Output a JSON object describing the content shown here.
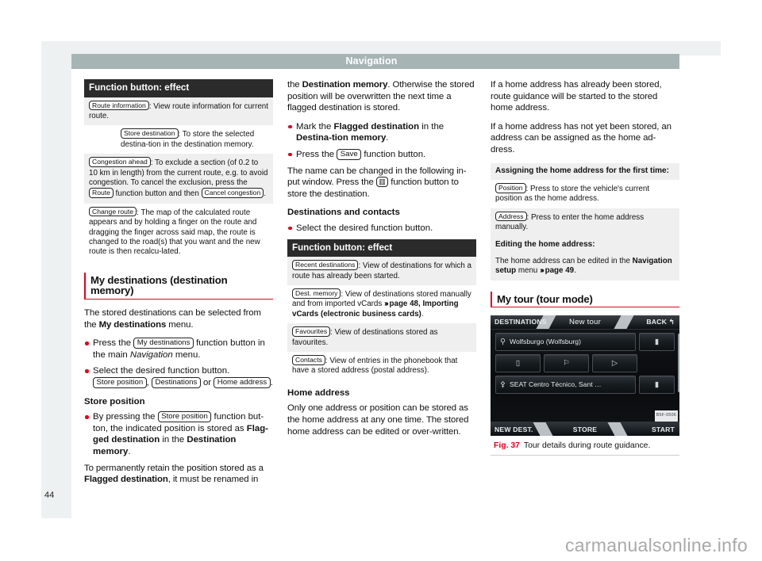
{
  "header": {
    "title": "Navigation"
  },
  "page_number": "44",
  "watermark": "carmanualsonline.info",
  "col1": {
    "table": {
      "head": "Function button: effect",
      "rows": [
        {
          "pill": "Route information",
          "text": ": View route information for current route."
        },
        {
          "pill": "Store destination",
          "text": ": To store the selected destina-tion in the destination memory."
        },
        {
          "pill": "Congestion ahead",
          "text": ": To exclude a section (of 0.2 to 10 km in length) from the current route, e.g. to avoid congestion. To cancel the exclusion, press the ",
          "pill2": "Route",
          "text2": " function button and then ",
          "pill3": "Cancel congestion",
          "text3": "."
        },
        {
          "pill": "Change route",
          "text": ": The map of the calculated route appears and by holding a finger on the route and dragging the finger across said map, the route is changed to the road(s) that you want and the new route is then recalcu-lated."
        }
      ]
    },
    "section_heading": "My destinations (destination memory)",
    "intro_a": "The stored destinations can be selected from the ",
    "intro_b": "My destinations",
    "intro_c": " menu.",
    "bullet1_a": "Press the ",
    "bullet1_pill": "My destinations",
    "bullet1_b": " function button in the main ",
    "bullet1_italic": "Navigation",
    "bullet1_c": " menu.",
    "bullet2": "Select the desired function button.",
    "bullet2_pill1": "Store position",
    "bullet2_sep1": ", ",
    "bullet2_pill2": "Destinations",
    "bullet2_sep2": " or ",
    "bullet2_pill3": "Home address",
    "bullet2_end": ".",
    "sub_store_position": "Store position",
    "bullet3_a": "By pressing the ",
    "bullet3_pill": "Store position",
    "bullet3_b": " function but-ton, the indicated position is stored as ",
    "bullet3_bold1": "Flag-ged destination",
    "bullet3_c": " in the ",
    "bullet3_bold2": "Destination memory",
    "bullet3_d": ".",
    "para_retain_a": "To permanently retain the position stored as a ",
    "para_retain_bold": "Flagged destination",
    "para_retain_b": ", it must be renamed in"
  },
  "col2": {
    "cont_a": "the ",
    "cont_bold": "Destination memory",
    "cont_b": ". Otherwise the stored position will be overwritten the next time a flagged destination is stored.",
    "bullet1_a": "Mark the ",
    "bullet1_bold1": "Flagged destination",
    "bullet1_b": " in the ",
    "bullet1_bold2": "Destina-tion memory",
    "bullet1_c": ".",
    "bullet2_a": "Press the ",
    "bullet2_pill": "Save",
    "bullet2_b": " function button.",
    "para_name_a": "The name can be changed in the following in-put window. Press the ",
    "para_name_glyph": "▥",
    "para_name_b": " function button to store the destination.",
    "sub_destinations": "Destinations and contacts",
    "bullet3": "Select the desired function button.",
    "table": {
      "head": "Function button: effect",
      "rows": [
        {
          "pill": "Recent destinations",
          "text": ": View of destinations for which a route has already been started."
        },
        {
          "pill": "Dest. memory",
          "text": ": View of destinations stored manually and from imported vCards ",
          "ref": "page 48, Importing vCards (electronic business cards)",
          "tail": "."
        },
        {
          "pill": "Favourites",
          "text": ": View of destinations stored as favourites."
        },
        {
          "pill": "Contacts",
          "text": ": View of entries in the phonebook that have a stored address (postal address)."
        }
      ]
    },
    "sub_home_address": "Home address",
    "para_home": "Only one address or position can be stored as the home address at any one time. The stored home address can be edited or over-written."
  },
  "col3": {
    "para1": "If a home address has already been stored, route guidance will be started to the stored home address.",
    "para2": "If a home address has not yet been stored, an address can be assigned as the home ad-dress.",
    "table": {
      "head_assigning": "Assigning the home address for the first time:",
      "rows": [
        {
          "pill": "Position",
          "text": ": Press to store the vehicle's current position as the home address."
        },
        {
          "pill": "Address",
          "text": ": Press to enter the home address manually."
        }
      ],
      "head_editing": "Editing the home address:",
      "edit_a": "The home address can be edited in the ",
      "edit_bold": "Navigation setup",
      "edit_b": " menu ",
      "edit_ref": "page 49",
      "edit_c": "."
    },
    "section_heading": "My tour (tour mode)",
    "figure": {
      "screen": {
        "top_left": "DESTINATIONS",
        "top_title": "New tour",
        "top_right": "BACK",
        "back_icon": "↰",
        "rows": [
          {
            "icon": "destination-pin-icon",
            "glyph": "⚲",
            "label": "Wolfsburgo (Wolfsburg)",
            "action_glyph": "▮",
            "action_name": "delete-icon"
          },
          {
            "icons": [
              {
                "name": "battery-icon",
                "glyph": "▯"
              },
              {
                "name": "flag-icon",
                "glyph": "⚐"
              },
              {
                "name": "play-icon",
                "glyph": "▷"
              }
            ]
          },
          {
            "icon": "destination-target-icon",
            "glyph": "⚴",
            "label": "SEAT Centro Técnico, Sant …",
            "action_glyph": "▮",
            "action_name": "delete-icon"
          }
        ],
        "bottom_left": "NEW DEST.",
        "bottom_center": "STORE",
        "bottom_right": "START",
        "image_code": "B5F-0506"
      },
      "caption_number": "Fig. 37",
      "caption_text": "Tour details during route guidance."
    }
  }
}
